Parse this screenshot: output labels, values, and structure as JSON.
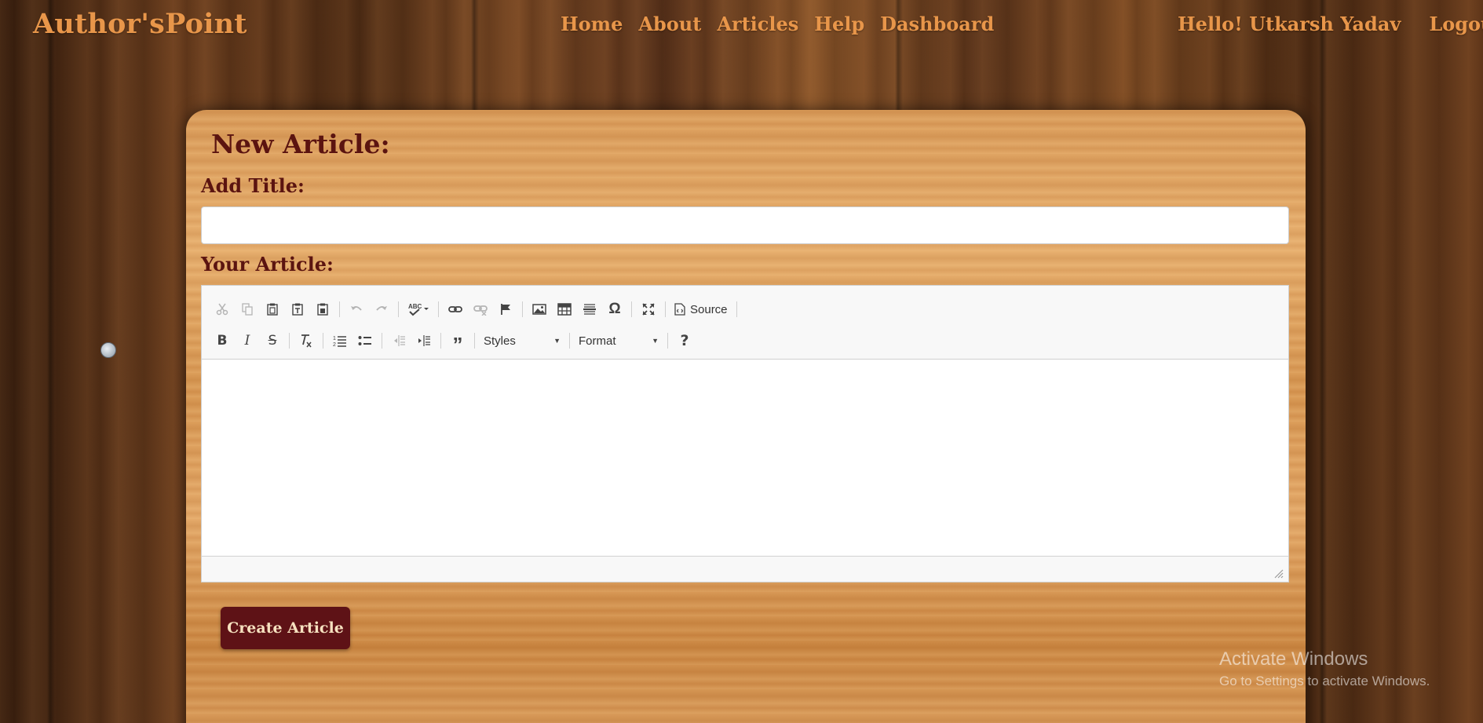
{
  "nav": {
    "brand": "Author'sPoint",
    "links": [
      "Home",
      "About",
      "Articles",
      "Help",
      "Dashboard"
    ],
    "greeting": "Hello! Utkarsh Yadav",
    "logout": "Logout"
  },
  "form": {
    "heading": "New Article:",
    "title_label": "Add Title:",
    "title_value": "",
    "article_label": "Your Article:",
    "submit_label": "Create Article"
  },
  "editor": {
    "toolbar_row1": [
      {
        "name": "cut",
        "enabled": false
      },
      {
        "name": "copy",
        "enabled": false
      },
      {
        "name": "paste",
        "enabled": true
      },
      {
        "name": "paste-text",
        "enabled": true
      },
      {
        "name": "paste-from-word",
        "enabled": true
      },
      {
        "name": "undo",
        "enabled": false
      },
      {
        "name": "redo",
        "enabled": false
      },
      {
        "name": "spellcheck",
        "enabled": true
      },
      {
        "name": "link",
        "enabled": true
      },
      {
        "name": "unlink",
        "enabled": false
      },
      {
        "name": "anchor",
        "enabled": true
      },
      {
        "name": "image",
        "enabled": true
      },
      {
        "name": "table",
        "enabled": true
      },
      {
        "name": "horizontal-rule",
        "enabled": true
      },
      {
        "name": "special-char",
        "enabled": true
      },
      {
        "name": "maximize",
        "enabled": true
      }
    ],
    "source_label": "Source",
    "styles_label": "Styles",
    "format_label": "Format",
    "content": ""
  },
  "watermark": {
    "line1": "Activate Windows",
    "line2": "Go to Settings to activate Windows."
  },
  "colors": {
    "brand": "#e8964a",
    "label": "#5b1410",
    "button_bg": "#5e1216",
    "button_text": "#f6e1bf"
  }
}
